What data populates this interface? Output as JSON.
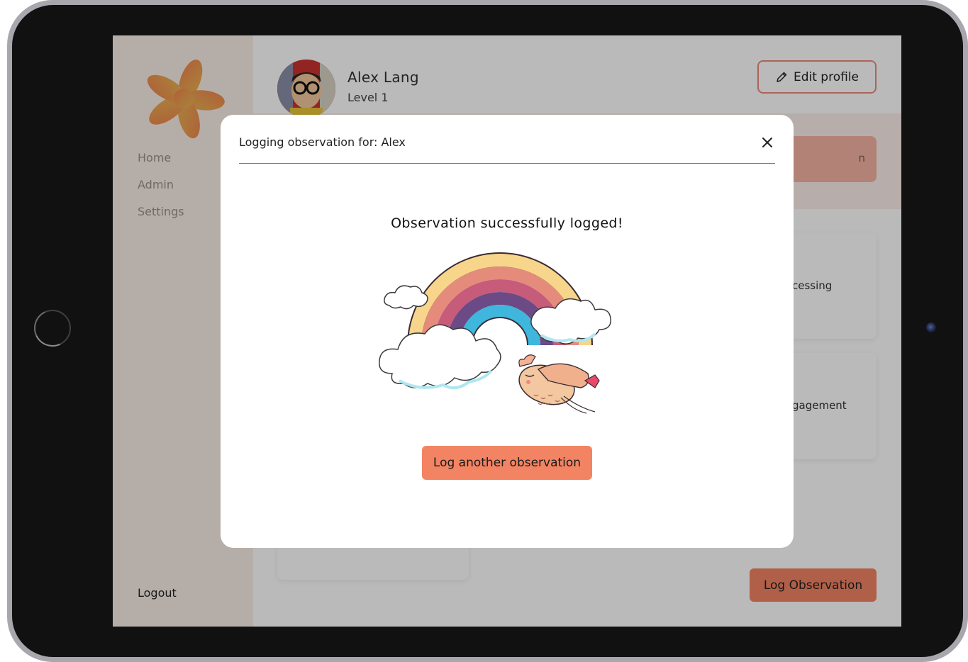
{
  "sidebar": {
    "items": [
      {
        "label": "Home"
      },
      {
        "label": "Admin"
      },
      {
        "label": "Settings"
      }
    ],
    "logout_label": "Logout"
  },
  "profile": {
    "name": "Alex Lang",
    "level": "Level 1",
    "edit_label": "Edit profile"
  },
  "background": {
    "peach_bar_text": "n",
    "card1_text": "cessing",
    "card2_text": "gagement",
    "log_observation_label": "Log Observation"
  },
  "modal": {
    "title": "Logging observation for: Alex",
    "success_message": "Observation successfully logged!",
    "action_label": "Log another observation"
  },
  "colors": {
    "accent": "#f28463",
    "accent_border": "#e98a7a",
    "sidebar_bg": "#f8efe7"
  },
  "icons": [
    "flower-logo-icon",
    "pencil-icon",
    "close-icon",
    "rainbow-illustration",
    "bird-illustration"
  ]
}
